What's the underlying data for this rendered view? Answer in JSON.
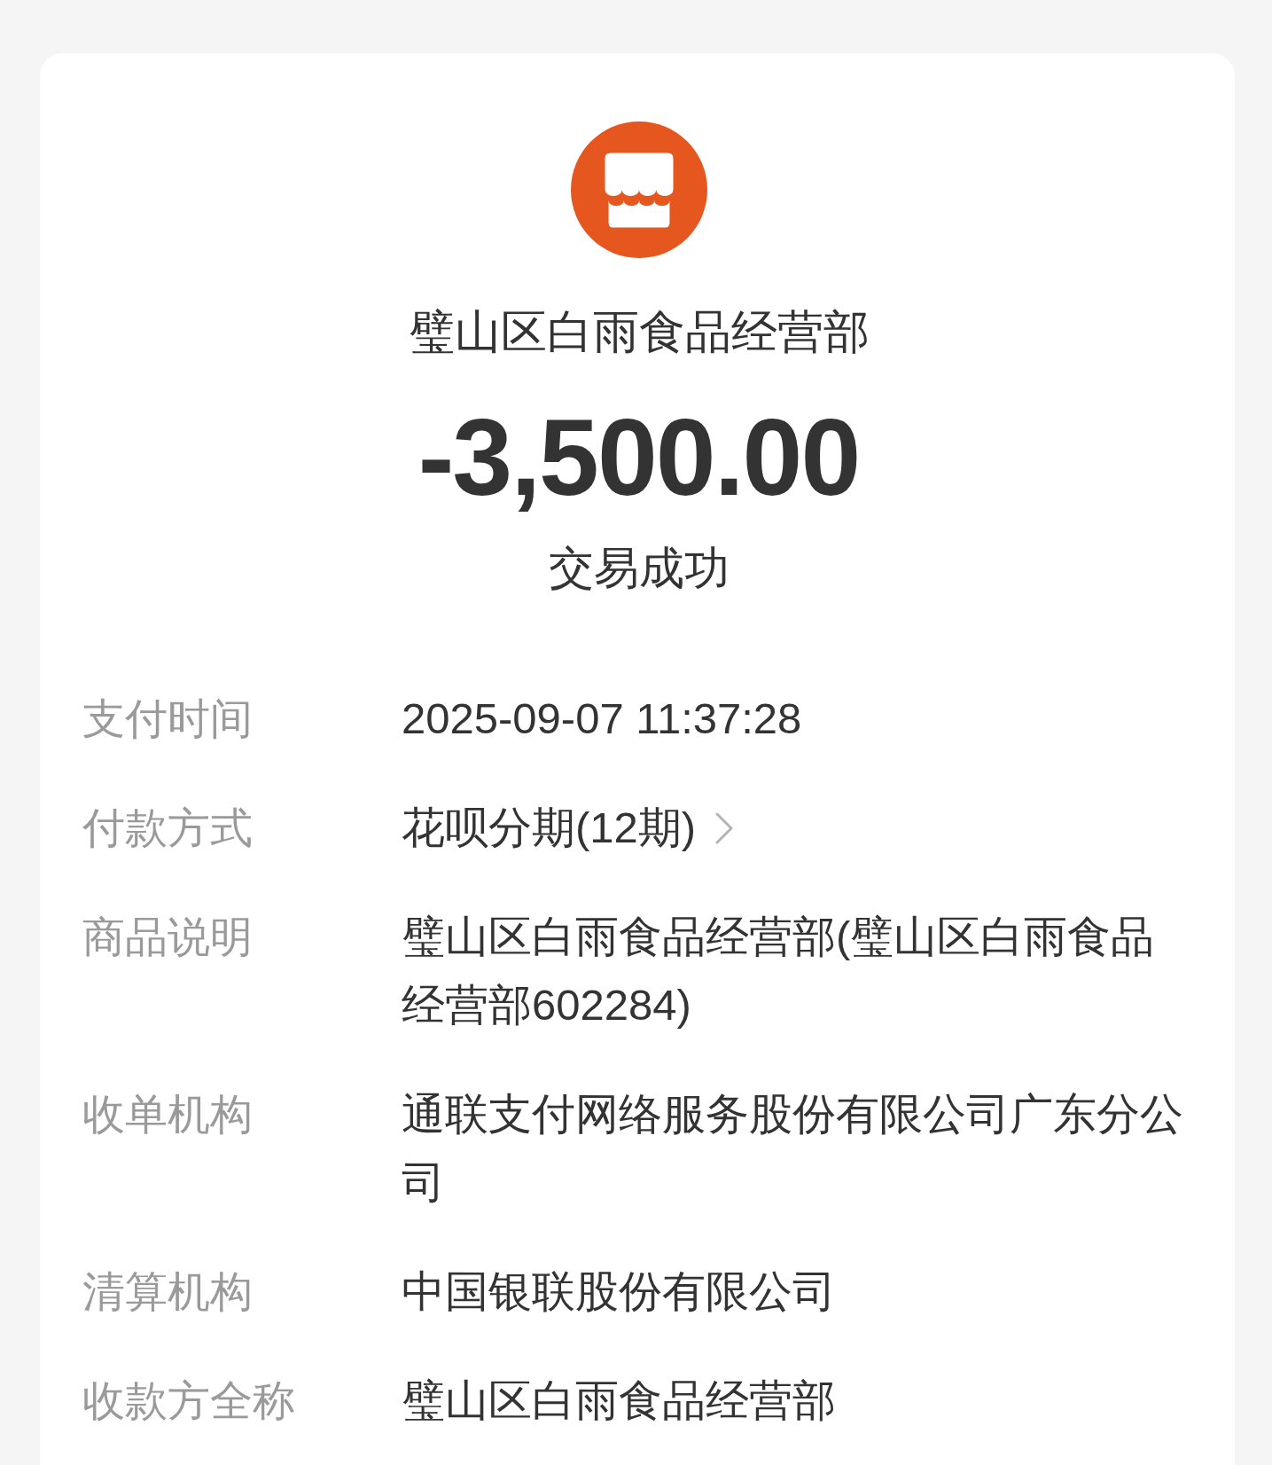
{
  "merchant": {
    "name": "璧山区白雨食品经营部"
  },
  "amount": "-3,500.00",
  "status": "交易成功",
  "details": [
    {
      "kind": "text",
      "label": "支付时间",
      "value": "2025-09-07 11:37:28"
    },
    {
      "kind": "link",
      "label": "付款方式",
      "value": "花呗分期(12期)"
    },
    {
      "kind": "text",
      "label": "商品说明",
      "value": "璧山区白雨食品经营部(璧山区白雨食品经营部602284)"
    },
    {
      "kind": "text",
      "label": "收单机构",
      "value": "通联支付网络服务股份有限公司广东分公司"
    },
    {
      "kind": "text",
      "label": "清算机构",
      "value": "中国银联股份有限公司"
    },
    {
      "kind": "text",
      "label": "收款方全称",
      "value": "璧山区白雨食品经营部"
    }
  ]
}
